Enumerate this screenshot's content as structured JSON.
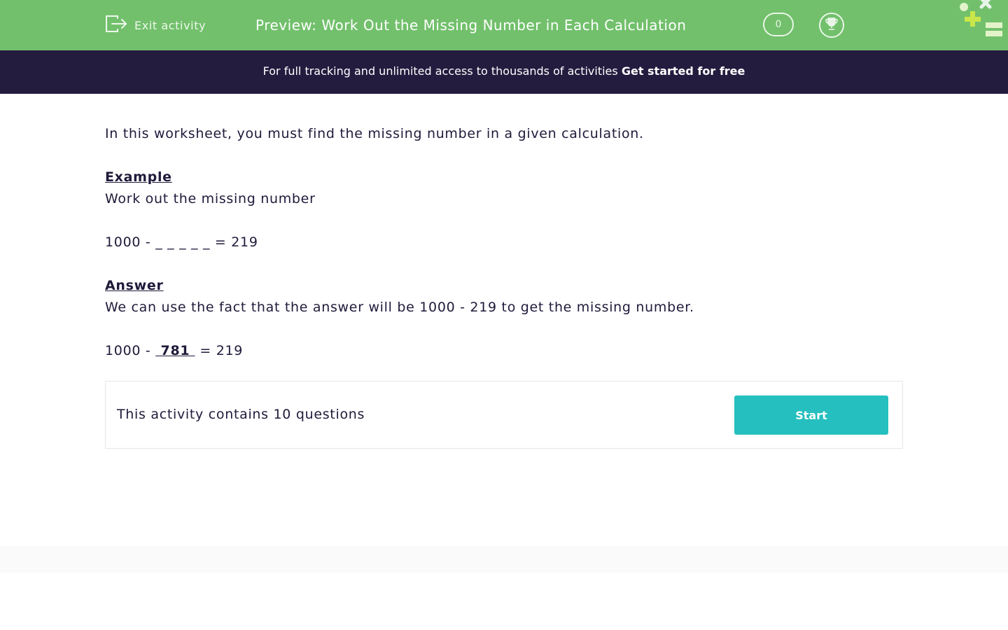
{
  "header": {
    "exit_label": "Exit activity",
    "title": "Preview: Work Out the Missing Number in Each Calculation",
    "score": "0",
    "bg_color": "#72c06c"
  },
  "promo": {
    "text": "For full tracking and unlimited access to thousands of activities ",
    "link": "Get started for free",
    "bg_color": "#241c3f"
  },
  "intro": {
    "text": "In this worksheet, you must find the missing number in a given calculation."
  },
  "example": {
    "heading": "Example",
    "prompt": "Work out the missing number",
    "calc_left": "1000 - ",
    "calc_blank": "_ _ _ _ _",
    "calc_right": " = 219"
  },
  "answer": {
    "heading": "Answer",
    "explanation": "We can use the fact that the answer will be 1000 - 219 to get the missing number.",
    "calc_left": "1000 - ",
    "calc_blank": " 781 ",
    "calc_right": " = 219"
  },
  "activity": {
    "info": "This activity contains 10 questions",
    "start_label": "Start",
    "start_color": "#25bfbf"
  }
}
